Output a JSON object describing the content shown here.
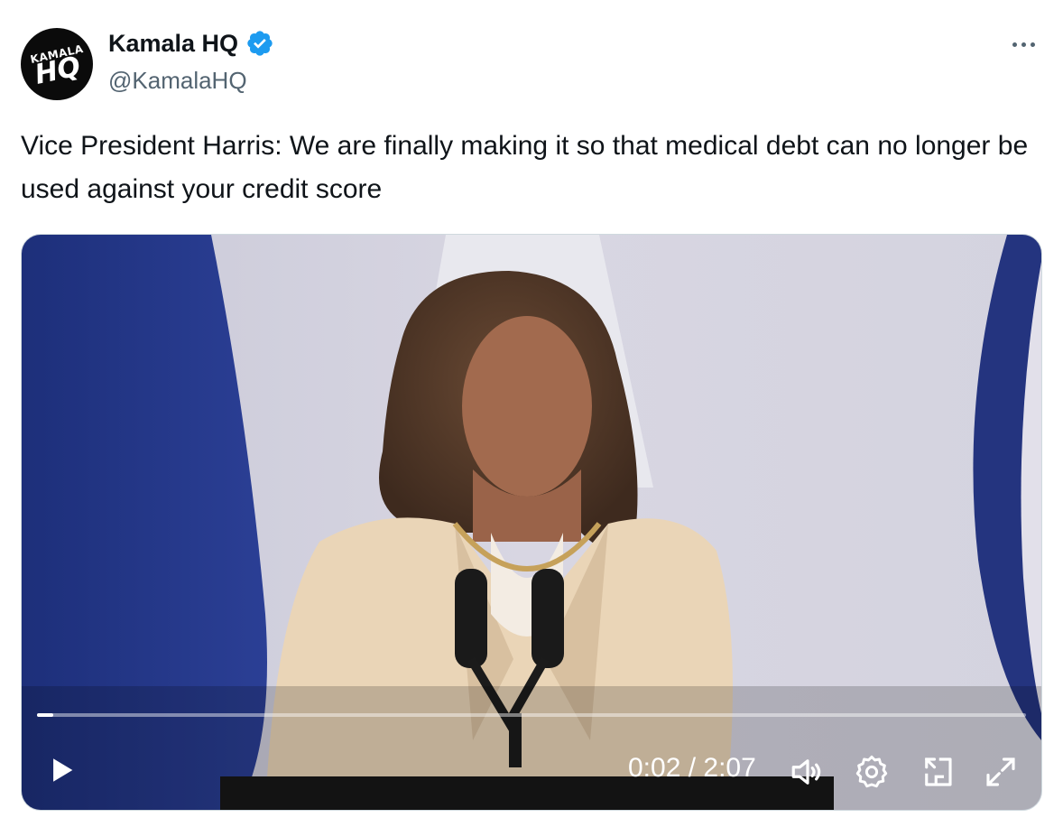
{
  "author": {
    "avatar_line1": "KAMALA",
    "avatar_line2": "HQ",
    "name": "Kamala HQ",
    "handle": "@KamalaHQ",
    "verified_color": "#1d9bf0"
  },
  "tweet": {
    "text": "Vice President Harris: We are finally making it so that medical debt can no longer be used against your credit score"
  },
  "video": {
    "time_display": "0:02 / 2:07",
    "progress_fraction": 0.016,
    "icons": [
      "play-icon",
      "volume-icon",
      "settings-icon",
      "picture-in-picture-icon",
      "fullscreen-icon"
    ]
  }
}
